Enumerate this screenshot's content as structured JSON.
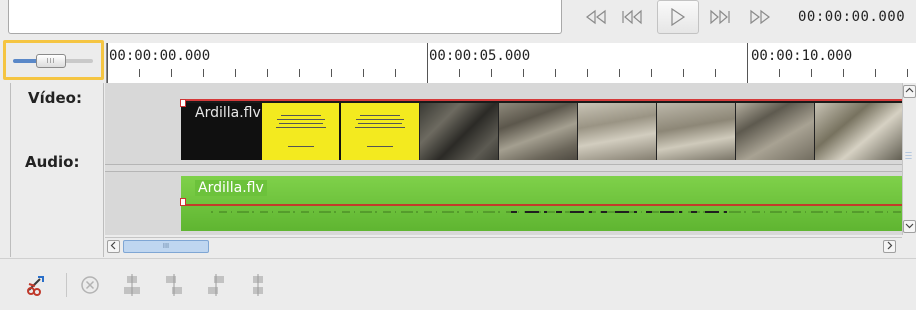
{
  "transport": {
    "timecode": "00:00:00.000"
  },
  "ruler": {
    "labels": [
      "00:00:00.000",
      "00:00:05.000",
      "00:00:10.000"
    ]
  },
  "tracks": {
    "video_label": "Vídeo:",
    "audio_label": "Audio:"
  },
  "clips": {
    "video_name": "Ardilla.flv",
    "audio_name": "Ardilla.flv"
  },
  "zoom": {
    "thumb_grip": "III"
  },
  "hscroll": {
    "thumb_grip": "III"
  },
  "colors": {
    "highlight": "#f5c542",
    "audio_clip": "#6cc23b",
    "clip_border": "#d43a3a",
    "slider_fill": "#5a88c8"
  },
  "icons": {
    "transport": [
      "rewind-icon",
      "skip-start-icon",
      "play-icon",
      "skip-end-icon",
      "fast-forward-icon"
    ],
    "toolbar": [
      "unlink-clip-icon",
      "delete-icon",
      "align-center-icon",
      "align-left-icon",
      "align-right-icon",
      "distribute-icon"
    ]
  }
}
